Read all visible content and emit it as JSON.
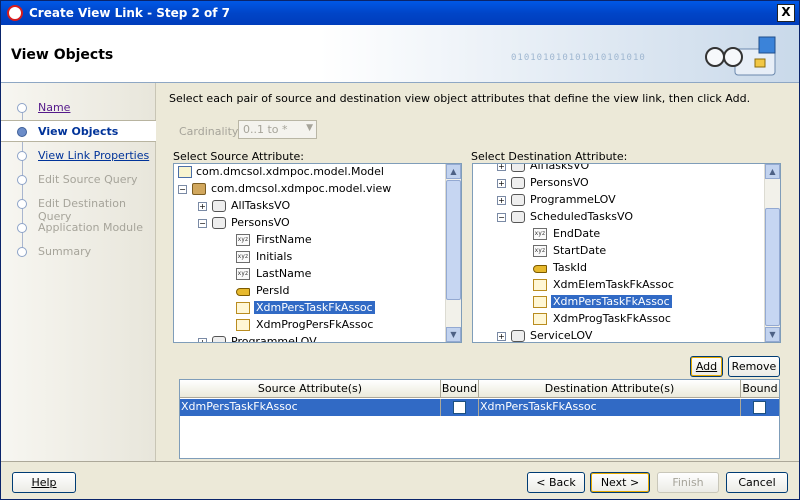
{
  "window": {
    "title": "Create View Link - Step 2 of 7",
    "close_glyph": "X"
  },
  "header": {
    "heading": "View Objects",
    "decor_binary": "010101010101010101010"
  },
  "steps": [
    {
      "label": "Name",
      "state": "visited"
    },
    {
      "label": "View Objects",
      "state": "current"
    },
    {
      "label": "View Link Properties",
      "state": "link"
    },
    {
      "label": "Edit Source Query",
      "state": "disabled"
    },
    {
      "label": "Edit Destination Query",
      "state": "disabled"
    },
    {
      "label": "Application Module",
      "state": "disabled"
    },
    {
      "label": "Summary",
      "state": "disabled"
    }
  ],
  "content": {
    "instructions": "Select each pair of source and destination view object attributes that define the view link, then click Add.",
    "cardinality_label": "Cardinality:",
    "cardinality_value": "0..1 to *"
  },
  "source_tree": {
    "label": "Select Source Attribute:",
    "rows": [
      "com.dmcsol.xdmpoc.model.Model",
      "com.dmcsol.xdmpoc.model.view",
      "AllTasksVO",
      "PersonsVO",
      "FirstName",
      "Initials",
      "LastName",
      "PersId",
      "XdmPersTaskFkAssoc",
      "XdmProgPersFkAssoc",
      "ProgrammeLOV"
    ]
  },
  "dest_tree": {
    "label": "Select Destination Attribute:",
    "rows": [
      "AllTasksVO",
      "PersonsVO",
      "ProgrammeLOV",
      "ScheduledTasksVO",
      "EndDate",
      "StartDate",
      "TaskId",
      "XdmElemTaskFkAssoc",
      "XdmPersTaskFkAssoc",
      "XdmProgTaskFkAssoc",
      "ServiceLOV"
    ]
  },
  "buttons": {
    "add": "Add",
    "remove": "Remove",
    "help": "Help",
    "back": "< Back",
    "next": "Next >",
    "finish": "Finish",
    "cancel": "Cancel"
  },
  "table": {
    "headers": [
      "Source Attribute(s)",
      "Bound",
      "Destination Attribute(s)",
      "Bound"
    ],
    "rows": [
      {
        "source": "XdmPersTaskFkAssoc",
        "source_bound": false,
        "dest": "XdmPersTaskFkAssoc",
        "dest_bound": false
      }
    ]
  },
  "icons": {
    "xyz_glyph": "xyz",
    "expand_glyph": "+",
    "collapse_glyph": "−",
    "scroll_up_glyph": "▲",
    "scroll_down_glyph": "▼",
    "dropdown_glyph": "▼"
  }
}
